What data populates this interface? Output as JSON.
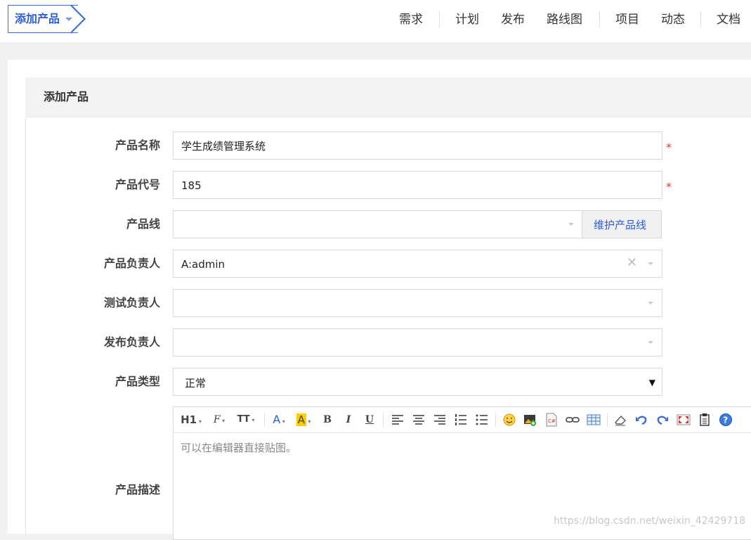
{
  "breadcrumb": {
    "label": "添加产品"
  },
  "nav": [
    "需求",
    "计划",
    "发布",
    "路线图",
    "项目",
    "动态",
    "文档"
  ],
  "panel": {
    "title": "添加产品"
  },
  "form": {
    "name": {
      "label": "产品名称",
      "value": "学生成绩管理系统",
      "required": "*"
    },
    "code": {
      "label": "产品代号",
      "value": "185",
      "required": "*"
    },
    "line": {
      "label": "产品线",
      "value": "",
      "button": "维护产品线"
    },
    "po": {
      "label": "产品负责人",
      "value": "A:admin",
      "clear": "✕"
    },
    "qd": {
      "label": "测试负责人",
      "value": ""
    },
    "rd": {
      "label": "发布负责人",
      "value": ""
    },
    "type": {
      "label": "产品类型",
      "value": "正常"
    },
    "desc": {
      "label": "产品描述",
      "placeholder": "可以在编辑器直接贴图。"
    }
  },
  "toolbar": {
    "heading": "H1",
    "font": "F",
    "fontsize": "TT",
    "color": "A",
    "bg": "A",
    "bold": "B",
    "italic": "I",
    "underline": "U"
  },
  "watermark": "https://blog.csdn.net/weixin_42429718",
  "colors": {
    "accent": "#2c5dd1",
    "required": "#e03030",
    "highlight": "#ffcc00"
  }
}
